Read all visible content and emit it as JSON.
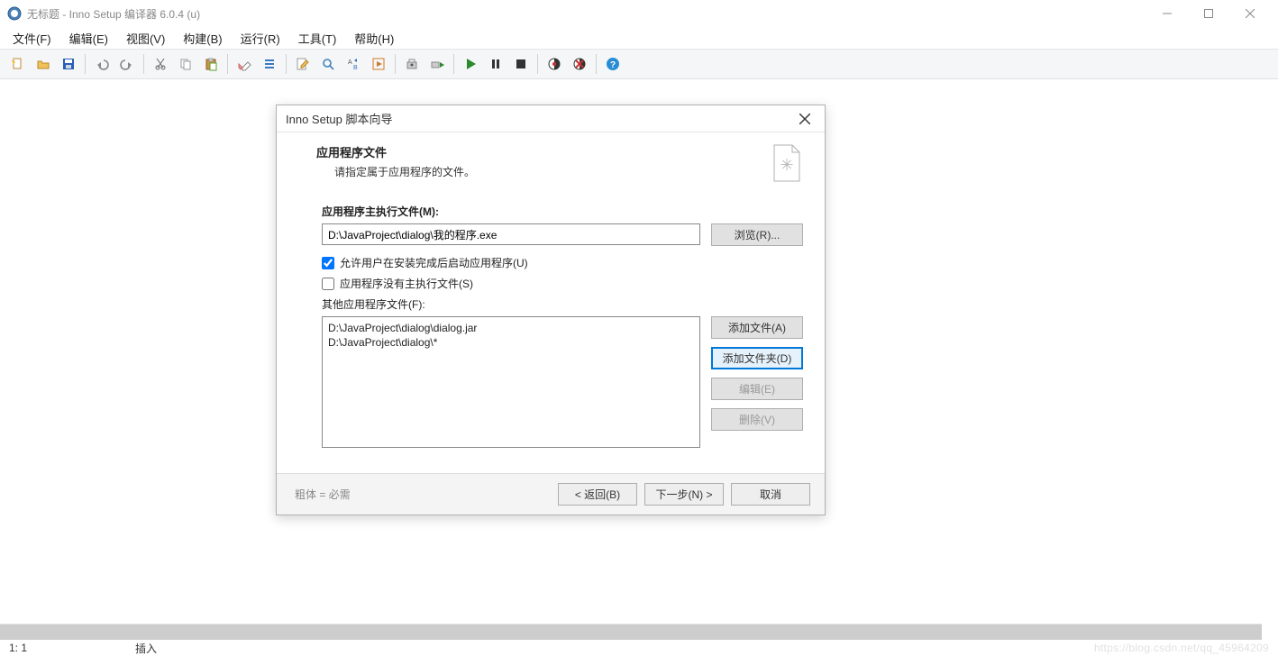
{
  "window": {
    "title": "无标题 - Inno Setup 编译器 6.0.4 (u)"
  },
  "menubar": {
    "items": [
      "文件(F)",
      "编辑(E)",
      "视图(V)",
      "构建(B)",
      "运行(R)",
      "工具(T)",
      "帮助(H)"
    ]
  },
  "toolbar": {
    "icons": [
      "new",
      "open",
      "save",
      "undo",
      "redo",
      "cut",
      "copy",
      "paste",
      "delete",
      "list",
      "edit-script",
      "find",
      "replace",
      "goto",
      "compile",
      "compile-run",
      "run",
      "pause",
      "stop",
      "target-debug",
      "target-xdebug",
      "help"
    ]
  },
  "statusbar": {
    "position": "1:   1",
    "mode": "插入"
  },
  "dialog": {
    "title": "Inno Setup 脚本向导",
    "header": {
      "title": "应用程序文件",
      "desc": "请指定属于应用程序的文件。"
    },
    "main_exe": {
      "label": "应用程序主执行文件(M):",
      "value": "D:\\JavaProject\\dialog\\我的程序.exe",
      "browse": "浏览(R)..."
    },
    "check1": "允许用户在安装完成后启动应用程序(U)",
    "check2": "应用程序没有主执行文件(S)",
    "other_files": {
      "label": "其他应用程序文件(F):",
      "items": [
        "D:\\JavaProject\\dialog\\dialog.jar",
        "D:\\JavaProject\\dialog\\*"
      ]
    },
    "side": {
      "add_file": "添加文件(A)",
      "add_folder": "添加文件夹(D)",
      "edit": "编辑(E)",
      "delete": "删除(V)"
    },
    "footer": {
      "hint": "粗体 = 必需",
      "back": "< 返回(B)",
      "next": "下一步(N) >",
      "cancel": "取消"
    }
  },
  "watermark": "https://blog.csdn.net/qq_45964209"
}
